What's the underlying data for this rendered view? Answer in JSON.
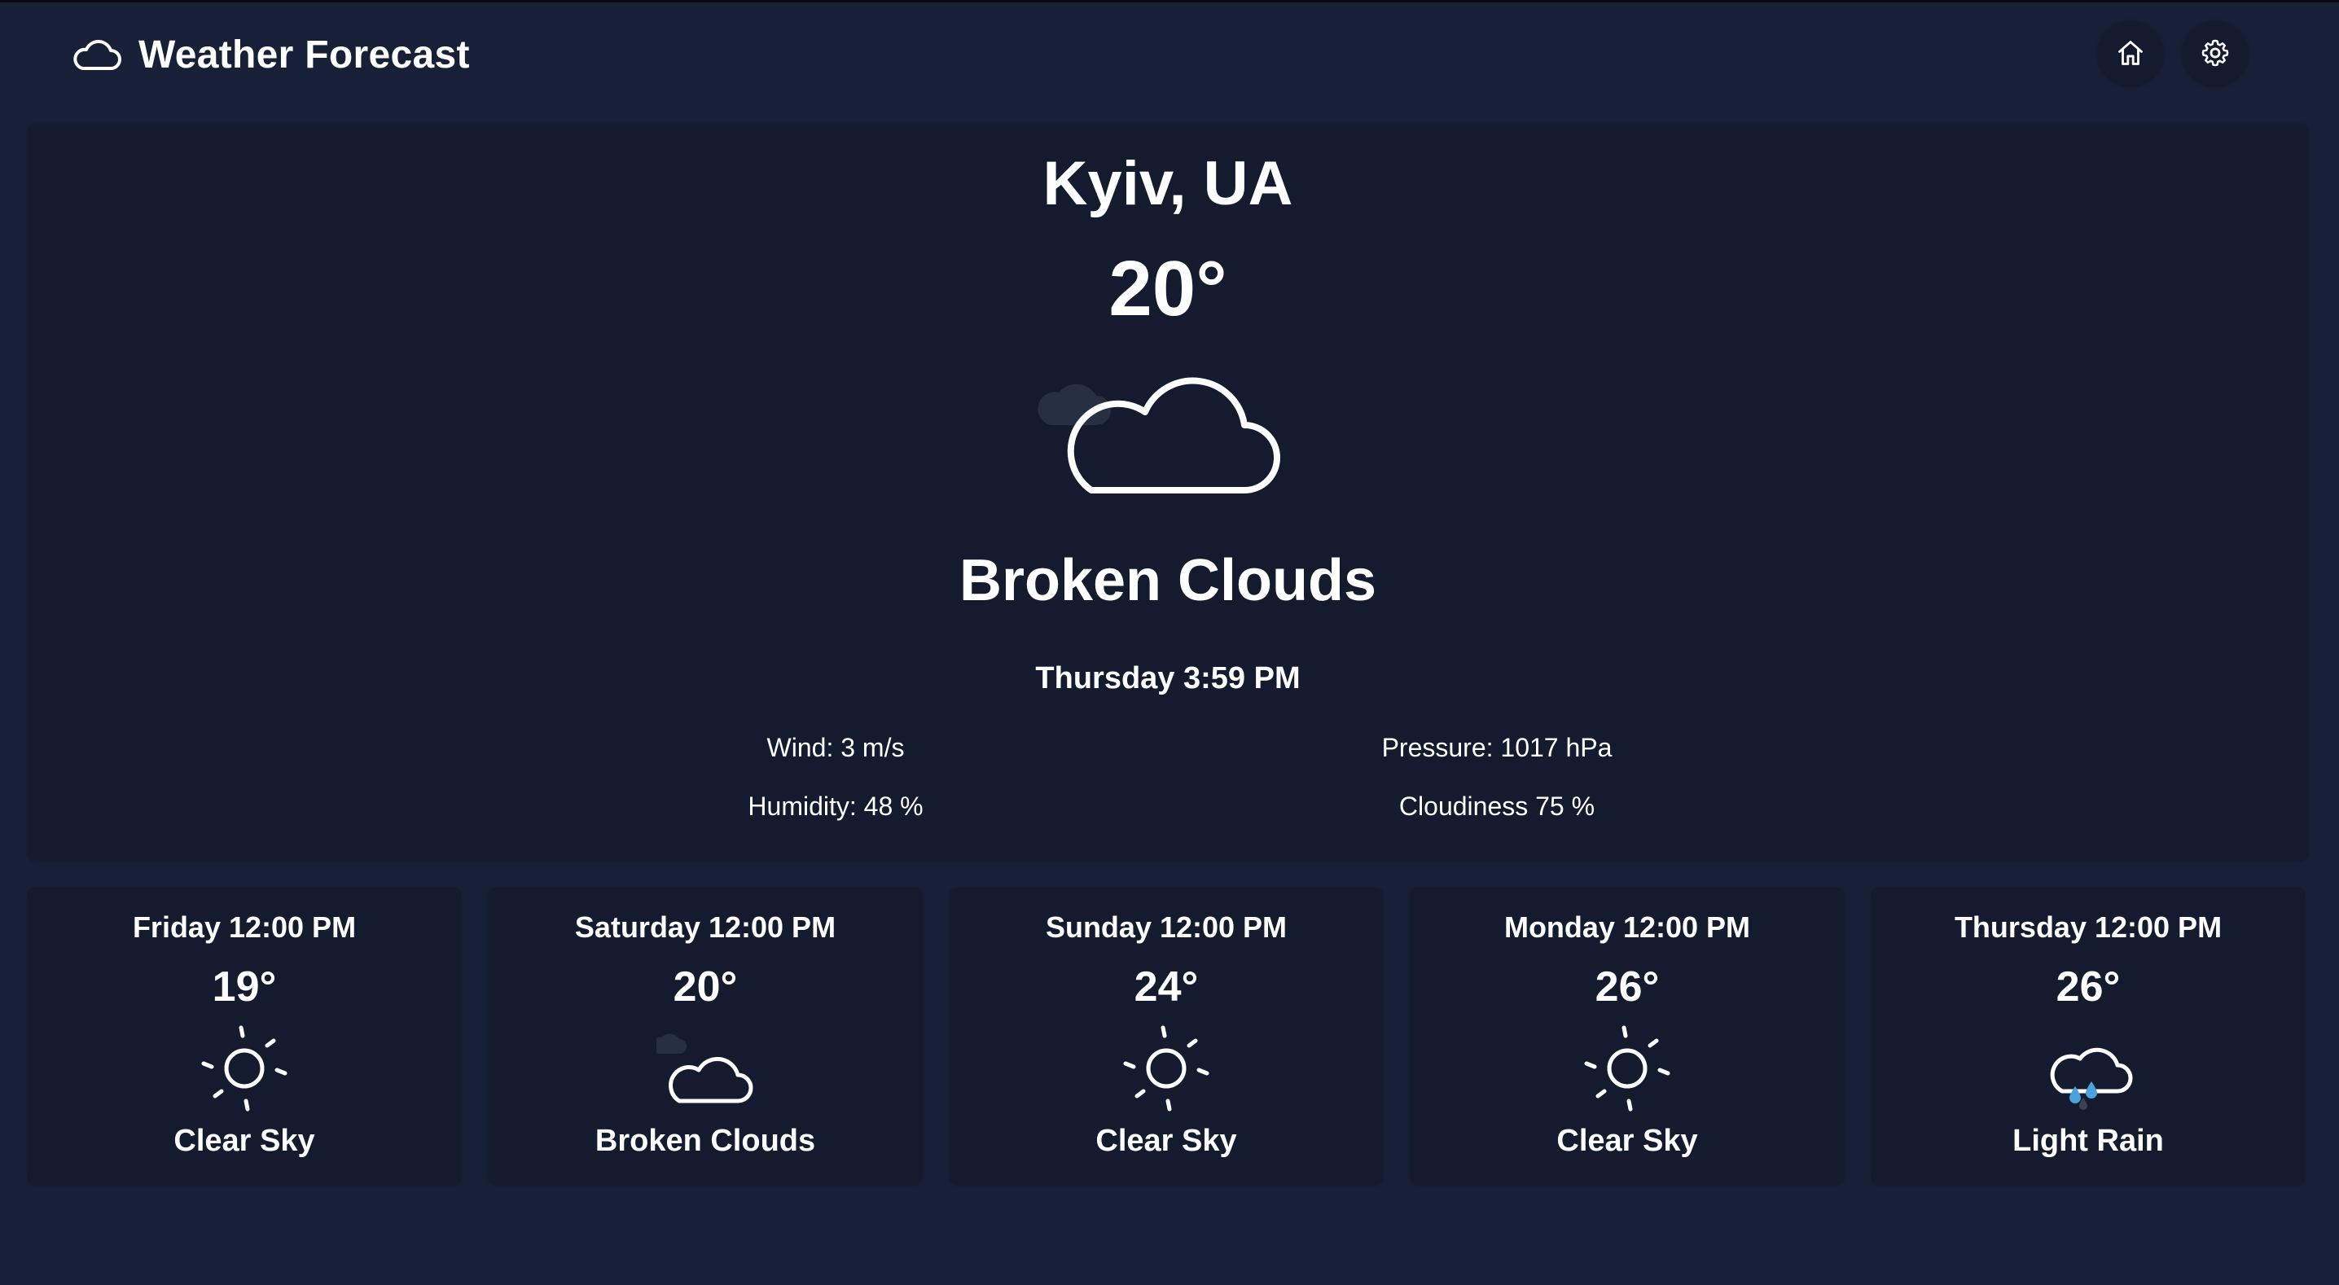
{
  "app": {
    "title": "Weather Forecast",
    "brand_icon": "cloud-icon",
    "home_icon": "home-icon",
    "settings_icon": "gear-icon"
  },
  "colors": {
    "background": "#172036",
    "card": "#151b2f",
    "text": "#ffffff",
    "rain_drop": "#4aa3df"
  },
  "current": {
    "city": "Kyiv, UA",
    "temperature": "20°",
    "icon": "broken-clouds-icon",
    "condition": "Broken Clouds",
    "datetime": "Thursday 3:59 PM",
    "wind": "Wind: 3 m/s",
    "pressure": "Pressure: 1017 hPa",
    "humidity": "Humidity: 48 %",
    "cloudiness": "Cloudiness 75 %"
  },
  "forecast": [
    {
      "day": "Friday 12:00 PM",
      "temp": "19°",
      "icon": "sun-icon",
      "condition": "Clear Sky"
    },
    {
      "day": "Saturday 12:00 PM",
      "temp": "20°",
      "icon": "broken-clouds-icon",
      "condition": "Broken Clouds"
    },
    {
      "day": "Sunday 12:00 PM",
      "temp": "24°",
      "icon": "sun-icon",
      "condition": "Clear Sky"
    },
    {
      "day": "Monday 12:00 PM",
      "temp": "26°",
      "icon": "sun-icon",
      "condition": "Clear Sky"
    },
    {
      "day": "Thursday 12:00 PM",
      "temp": "26°",
      "icon": "light-rain-icon",
      "condition": "Light Rain"
    }
  ]
}
